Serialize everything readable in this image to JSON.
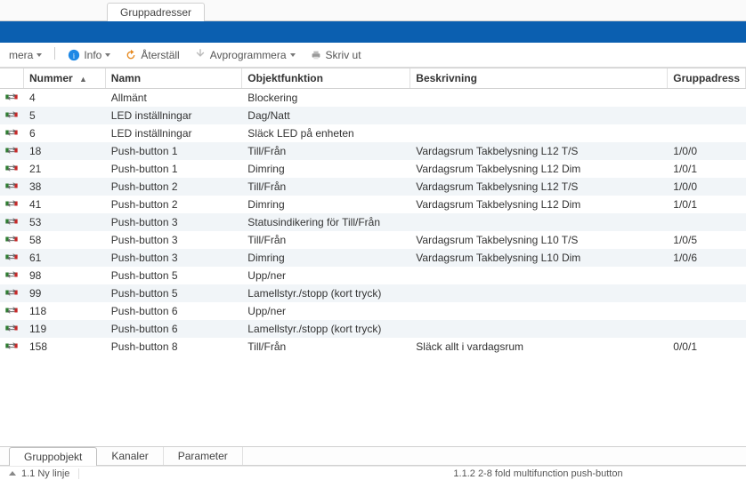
{
  "top_tabs": {
    "group_addresses": "Gruppadresser"
  },
  "toolbar": {
    "mera": "mera",
    "info": "Info",
    "reset": "Återställ",
    "unprogram": "Avprogrammera",
    "print": "Skriv ut"
  },
  "columns": {
    "nummer": "Nummer",
    "namn": "Namn",
    "objektfunktion": "Objektfunktion",
    "beskrivning": "Beskrivning",
    "gruppadress": "Gruppadress"
  },
  "rows": [
    {
      "num": "4",
      "name": "Allmänt",
      "func": "Blockering",
      "desc": "",
      "ga": ""
    },
    {
      "num": "5",
      "name": "LED inställningar",
      "func": "Dag/Natt",
      "desc": "",
      "ga": ""
    },
    {
      "num": "6",
      "name": "LED inställningar",
      "func": "Släck LED på enheten",
      "desc": "",
      "ga": ""
    },
    {
      "num": "18",
      "name": "Push-button 1",
      "func": "Till/Från",
      "desc": "Vardagsrum Takbelysning L12 T/S",
      "ga": "1/0/0"
    },
    {
      "num": "21",
      "name": "Push-button 1",
      "func": "Dimring",
      "desc": "Vardagsrum Takbelysning L12 Dim",
      "ga": "1/0/1"
    },
    {
      "num": "38",
      "name": "Push-button 2",
      "func": "Till/Från",
      "desc": "Vardagsrum Takbelysning L12 T/S",
      "ga": "1/0/0"
    },
    {
      "num": "41",
      "name": "Push-button 2",
      "func": "Dimring",
      "desc": "Vardagsrum Takbelysning L12 Dim",
      "ga": "1/0/1"
    },
    {
      "num": "53",
      "name": "Push-button 3",
      "func": "Statusindikering för Till/Från",
      "desc": "",
      "ga": ""
    },
    {
      "num": "58",
      "name": "Push-button 3",
      "func": "Till/Från",
      "desc": "Vardagsrum Takbelysning L10 T/S",
      "ga": "1/0/5"
    },
    {
      "num": "61",
      "name": "Push-button 3",
      "func": "Dimring",
      "desc": "Vardagsrum Takbelysning L10 Dim",
      "ga": "1/0/6"
    },
    {
      "num": "98",
      "name": "Push-button 5",
      "func": "Upp/ner",
      "desc": "",
      "ga": ""
    },
    {
      "num": "99",
      "name": "Push-button 5",
      "func": "Lamellstyr./stopp (kort tryck)",
      "desc": "",
      "ga": ""
    },
    {
      "num": "118",
      "name": "Push-button 6",
      "func": "Upp/ner",
      "desc": "",
      "ga": ""
    },
    {
      "num": "119",
      "name": "Push-button 6",
      "func": "Lamellstyr./stopp (kort tryck)",
      "desc": "",
      "ga": ""
    },
    {
      "num": "158",
      "name": "Push-button 8",
      "func": "Till/Från",
      "desc": "Släck allt i vardagsrum",
      "ga": "0/0/1"
    }
  ],
  "bottom_tabs": {
    "gruppobjekt": "Gruppobjekt",
    "kanaler": "Kanaler",
    "parameter": "Parameter"
  },
  "statusbar": {
    "line": "1.1 Ny linje",
    "device": "1.1.2 2-8 fold multifunction push-button"
  }
}
